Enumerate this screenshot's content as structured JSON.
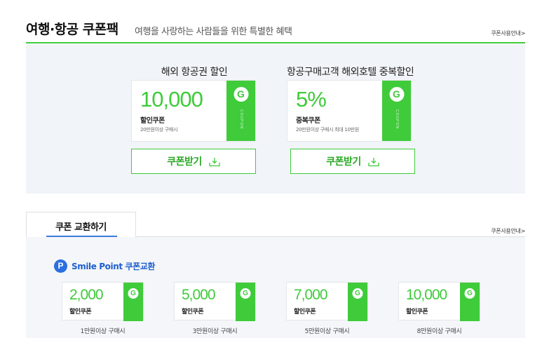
{
  "header": {
    "title": "여행·항공 쿠폰팩",
    "subtitle": "여행을 사랑하는 사람들을 위한 특별한 혜택",
    "guide_link": "쿠폰사용안내>"
  },
  "top_coupons": [
    {
      "title": "해외 항공권 할인",
      "amount": "10,000",
      "label": "할인쿠폰",
      "condition": "20만원이상 구매시",
      "tab_letter": "G",
      "tab_text": "COUPON",
      "button_label": "쿠폰받기"
    },
    {
      "title": "항공구매고객 해외호텔 중복할인",
      "amount": "5%",
      "label": "중복쿠폰",
      "condition": "20만원이상 구매시 최대 10만원",
      "tab_letter": "G",
      "tab_text": "COUPON",
      "button_label": "쿠폰받기"
    }
  ],
  "exchange": {
    "tab_label": "쿠폰 교환하기",
    "guide_link": "쿠폰사용안내>",
    "smile_point": {
      "logo_letter": "P",
      "title": "Smile Point 쿠폰교환"
    },
    "coupons": [
      {
        "amount": "2,000",
        "label": "할인쿠폰",
        "tab_letter": "G",
        "condition": "1만원이상 구매시"
      },
      {
        "amount": "5,000",
        "label": "할인쿠폰",
        "tab_letter": "G",
        "condition": "3만원이상 구매시"
      },
      {
        "amount": "7,000",
        "label": "할인쿠폰",
        "tab_letter": "G",
        "condition": "5만원이상 구매시"
      },
      {
        "amount": "10,000",
        "label": "할인쿠폰",
        "tab_letter": "G",
        "condition": "8만원이상 구매시"
      }
    ]
  },
  "colors": {
    "accent_green": "#3fcb3a",
    "smile_blue": "#2b6fe0",
    "panel_bg": "#f1f4f8"
  }
}
